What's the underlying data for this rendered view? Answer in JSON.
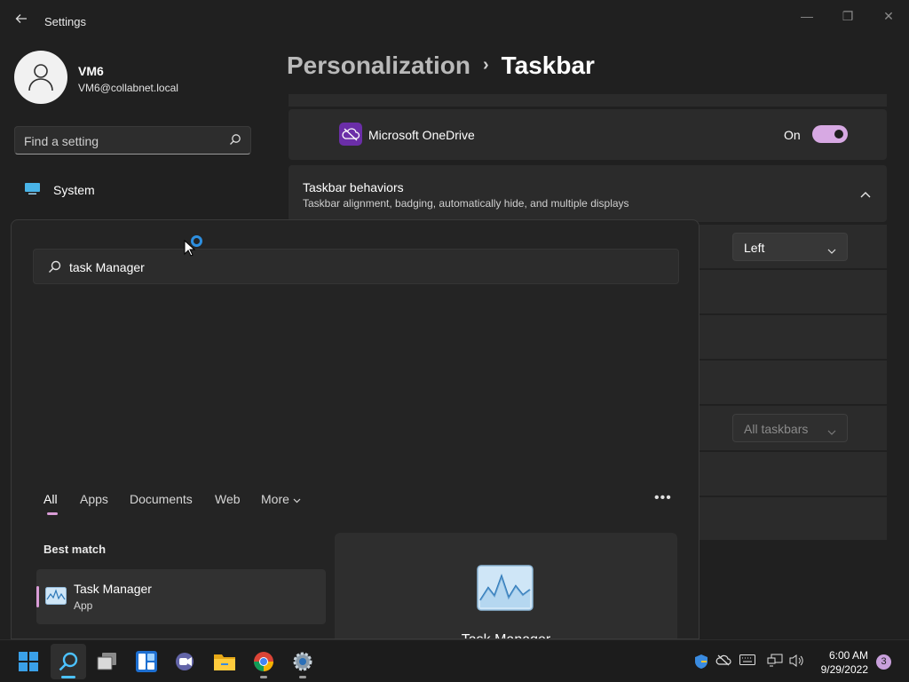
{
  "window": {
    "title": "Settings",
    "back_icon": "arrow-left-icon",
    "controls": {
      "minimize": "—",
      "maximize": "❐",
      "close": "✕"
    }
  },
  "user": {
    "name": "VM6",
    "email": "VM6@collabnet.local"
  },
  "search_settings": {
    "placeholder": "Find a setting"
  },
  "nav": {
    "items": [
      {
        "label": "System",
        "icon": "monitor-icon"
      }
    ]
  },
  "breadcrumb": {
    "parent": "Personalization",
    "separator": "›",
    "current": "Taskbar"
  },
  "onedrive": {
    "label": "Microsoft OneDrive",
    "state_label": "On",
    "enabled": true
  },
  "taskbar_behaviors": {
    "title": "Taskbar behaviors",
    "subtitle": "Taskbar alignment, badging, automatically hide, and multiple displays",
    "alignment_value": "Left",
    "multi_display_value": "All taskbars"
  },
  "start_search": {
    "query": "task Manager",
    "filters": [
      "All",
      "Apps",
      "Documents",
      "Web",
      "More"
    ],
    "active_filter": "All",
    "more_menu": "•••",
    "best_match_heading": "Best match",
    "result": {
      "name": "Task Manager",
      "type": "App"
    },
    "preview_title": "Task Manager"
  },
  "taskbar": {
    "apps": [
      "windows-start-icon",
      "search-icon",
      "task-view-icon",
      "widgets-icon",
      "teams-chat-icon",
      "file-explorer-icon",
      "chrome-icon",
      "settings-gear-icon"
    ],
    "tray": [
      "security-shield-icon",
      "onedrive-cloud-icon",
      "keyboard-icon",
      "network-icon",
      "volume-icon"
    ],
    "time": "6:00 AM",
    "date": "9/29/2022",
    "notification_count": "3"
  },
  "colors": {
    "accent": "#d99cd6",
    "toggle_on": "#d7a9e3",
    "window_bg": "#202020",
    "card_bg": "#2b2b2b"
  }
}
